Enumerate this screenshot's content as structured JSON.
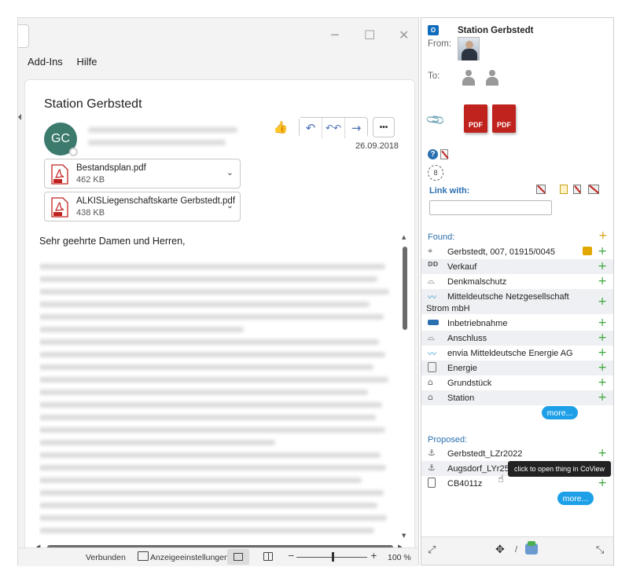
{
  "outlook": {
    "menu": [
      "Add-Ins",
      "Hilfe"
    ],
    "window_controls": {
      "minimize": "─",
      "maximize": "☐",
      "close": "✕"
    },
    "message": {
      "subject": "Station Gerbstedt",
      "avatar_initials": "GC",
      "date": "26.09.2018",
      "greeting": "Sehr geehrte Damen und Herren,",
      "attachments": [
        {
          "name": "Bestandsplan.pdf",
          "size": "462 KB"
        },
        {
          "name": "ALKISLiegenschaftskarte Gerbstedt.pdf",
          "size": "438 KB"
        }
      ],
      "actions": {
        "like": "👍",
        "reply": "↶",
        "reply_all": "↶↶",
        "forward": "→",
        "more": "•••"
      }
    },
    "status_bar": {
      "connection": "Verbunden",
      "display_settings": "Anzeigeeinstellungen",
      "zoom": "100 %",
      "zoom_minus": "−",
      "zoom_plus": "+"
    }
  },
  "side_panel": {
    "title": "Station Gerbstedt",
    "from_label": "From:",
    "to_label": "To:",
    "link_with_label": "Link with:",
    "found_label": "Found:",
    "proposed_label": "Proposed:",
    "found_items": [
      {
        "label": "Gerbstedt, 007, 01915/0045",
        "icon": "map-pin-icon",
        "locked": true
      },
      {
        "label": "Verkauf",
        "icon": "dd-icon"
      },
      {
        "label": "Denkmalschutz",
        "icon": "helmet-icon"
      },
      {
        "label": "Mitteldeutsche Netzgesellschaft",
        "label2": "Strom mbH",
        "icon": "company-icon"
      },
      {
        "label": "Inbetriebnahme",
        "icon": "tag-icon"
      },
      {
        "label": "Anschluss",
        "icon": "helmet-icon"
      },
      {
        "label": "envia Mitteldeutsche Energie AG",
        "icon": "company-icon"
      },
      {
        "label": "Energie",
        "icon": "document-icon"
      },
      {
        "label": "Grundstück",
        "icon": "house-icon"
      },
      {
        "label": "Station",
        "icon": "house-icon"
      }
    ],
    "proposed_items": [
      {
        "label": "Gerbstedt_LZr2022",
        "icon": "anchor-icon"
      },
      {
        "label": "Augsdorf_LYr25",
        "icon": "anchor-icon"
      },
      {
        "label": "CB4011z",
        "icon": "device-icon"
      }
    ],
    "more_label": "more...",
    "tooltip": "click to open thing in CoView",
    "pdf_label": "PDF",
    "plus": "+",
    "bottom_icons": {
      "expand": "⤢",
      "move": "✥",
      "separator": "/",
      "collapse": "⤡"
    }
  },
  "colors": {
    "accent_blue": "#1ea0e8",
    "plus_green": "#3aa63a",
    "pdf_red": "#c0231e",
    "avatar_teal": "#3c7a6e"
  }
}
